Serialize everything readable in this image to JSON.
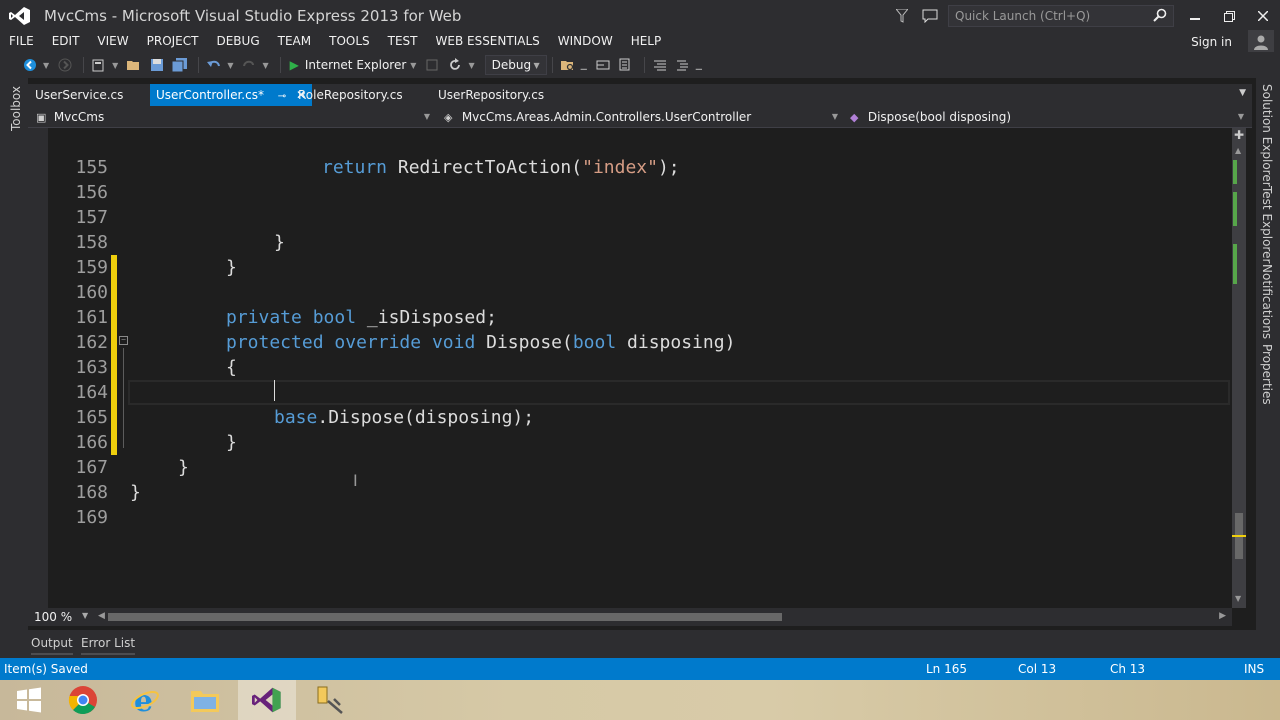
{
  "window": {
    "title": "MvcCms - Microsoft Visual Studio Express 2013 for Web",
    "quick_launch_placeholder": "Quick Launch (Ctrl+Q)"
  },
  "menu": [
    "FILE",
    "EDIT",
    "VIEW",
    "PROJECT",
    "DEBUG",
    "TEAM",
    "TOOLS",
    "TEST",
    "WEB ESSENTIALS",
    "WINDOW",
    "HELP"
  ],
  "account": {
    "sign_in": "Sign in"
  },
  "toolbar": {
    "run_target": "Internet Explorer",
    "configuration": "Debug"
  },
  "side_panels": {
    "left": [
      "Toolbox"
    ],
    "right": [
      "Solution Explorer",
      "Test Explorer",
      "Notifications",
      "Properties"
    ]
  },
  "tabs": [
    {
      "label": "UserService.cs",
      "active": false
    },
    {
      "label": "UserController.cs*",
      "active": true
    },
    {
      "label": "RoleRepository.cs",
      "active": false
    },
    {
      "label": "UserRepository.cs",
      "active": false
    }
  ],
  "navigation": {
    "project": "MvcCms",
    "type": "MvcCms.Areas.Admin.Controllers.UserController",
    "member": "Dispose(bool disposing)"
  },
  "editor": {
    "current_line": 165,
    "lines": [
      {
        "n": "155",
        "text": ""
      },
      {
        "n": "156",
        "text": ""
      },
      {
        "n": "157",
        "text": ""
      },
      {
        "n": "158",
        "text": ""
      },
      {
        "n": "159",
        "text": "}"
      },
      {
        "n": "160",
        "text": "}"
      },
      {
        "n": "161",
        "text": ""
      },
      {
        "n": "162",
        "text": ""
      },
      {
        "n": "163",
        "text": ""
      },
      {
        "n": "164",
        "text": "{"
      },
      {
        "n": "165",
        "text": ""
      },
      {
        "n": "166",
        "text": ""
      },
      {
        "n": "167",
        "text": "}"
      },
      {
        "n": "168",
        "text": "}"
      },
      {
        "n": "169",
        "text": "}"
      }
    ],
    "tokens": {
      "l156_kw": "return",
      "l156_a": " RedirectToAction(",
      "l156_str": "\"index\"",
      "l156_b": ");",
      "l162_kw1": "private",
      "l162_kw2": "bool",
      "l162_rest": " _isDisposed;",
      "l163_kw1": "protected",
      "l163_kw2": "override",
      "l163_kw3": "void",
      "l163_name": " Dispose(",
      "l163_kw4": "bool",
      "l163_rest": " disposing)",
      "l166_kw": "base",
      "l166_rest": ".Dispose(disposing);"
    }
  },
  "zoom": "100 %",
  "bottom_tabs": [
    "Output",
    "Error List"
  ],
  "status": {
    "message": "Item(s) Saved",
    "ln": "Ln 165",
    "col": "Col 13",
    "ch": "Ch 13",
    "mode": "INS"
  },
  "colors": {
    "accent": "#007acc",
    "keyword": "#569cd6",
    "string": "#d69d85",
    "changed_unsaved": "#efcf0d",
    "changed_saved": "#57a64a"
  },
  "taskbar": [
    "start-icon",
    "chrome-icon",
    "internet-explorer-icon",
    "file-explorer-icon",
    "visual-studio-icon",
    "tools-icon"
  ]
}
